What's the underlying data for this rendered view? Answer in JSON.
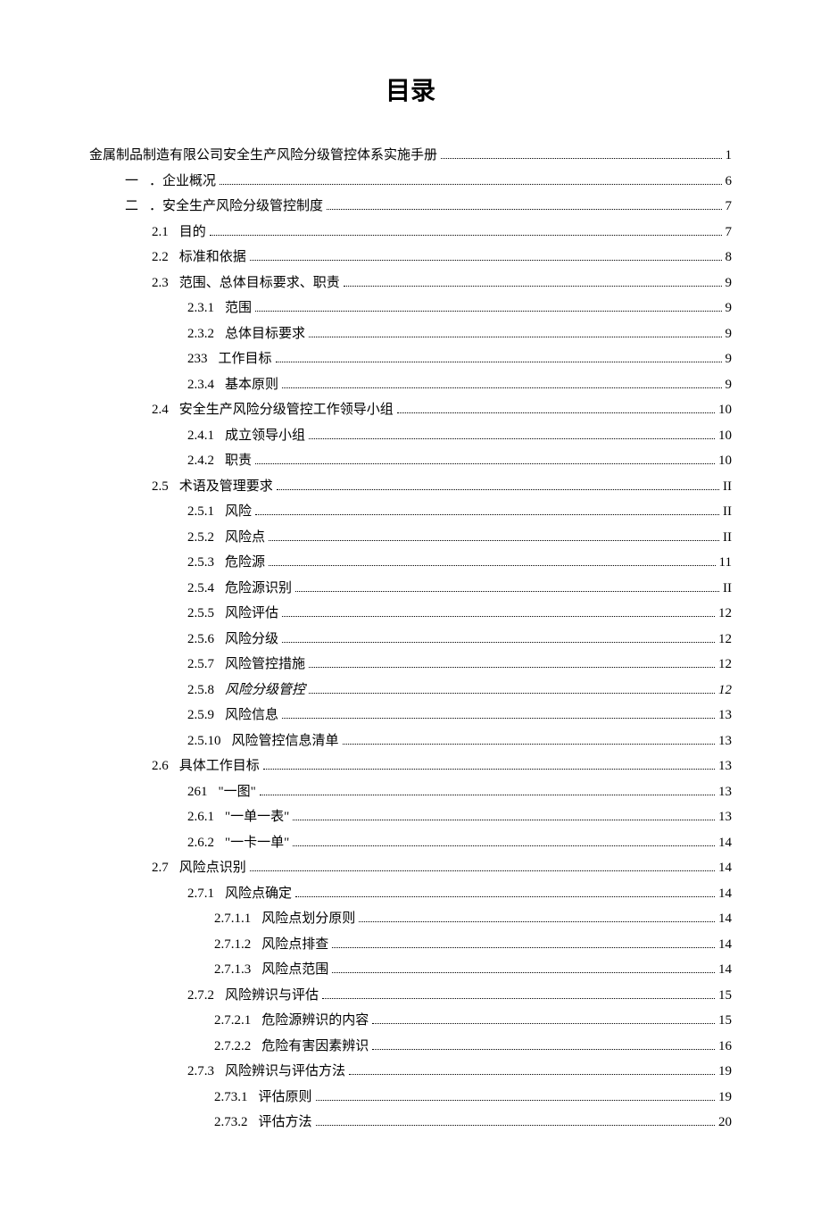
{
  "title": "目录",
  "entries": [
    {
      "indent": 0,
      "num": "",
      "label": "金属制品制造有限公司安全生产风险分级管控体系实施手册",
      "page": "1",
      "italic": false
    },
    {
      "indent": 1,
      "num": "一",
      "label": "．企业概况",
      "page": "6",
      "italic": false
    },
    {
      "indent": 1,
      "num": "二",
      "label": "．安全生产风险分级管控制度",
      "page": "7",
      "italic": false
    },
    {
      "indent": 2,
      "num": "2.1",
      "label": "目的",
      "page": "7",
      "italic": false
    },
    {
      "indent": 2,
      "num": "2.2",
      "label": "标准和依据",
      "page": "8",
      "italic": false
    },
    {
      "indent": 2,
      "num": "2.3",
      "label": "范围、总体目标要求、职责",
      "page": "9",
      "italic": false
    },
    {
      "indent": 3,
      "num": "2.3.1",
      "label": "范围",
      "page": "9",
      "italic": false
    },
    {
      "indent": 3,
      "num": "2.3.2",
      "label": "总体目标要求",
      "page": "9",
      "italic": false
    },
    {
      "indent": 3,
      "num": "233",
      "label": "工作目标",
      "page": "9",
      "italic": false
    },
    {
      "indent": 3,
      "num": "2.3.4",
      "label": "基本原则",
      "page": "9",
      "italic": false
    },
    {
      "indent": 2,
      "num": "2.4",
      "label": "安全生产风险分级管控工作领导小组",
      "page": "10",
      "italic": false
    },
    {
      "indent": 3,
      "num": "2.4.1",
      "label": "成立领导小组",
      "page": "10",
      "italic": false
    },
    {
      "indent": 3,
      "num": "2.4.2",
      "label": "职责",
      "page": "10",
      "italic": false
    },
    {
      "indent": 2,
      "num": "2.5",
      "label": "术语及管理要求",
      "page": "II",
      "italic": false
    },
    {
      "indent": 3,
      "num": "2.5.1",
      "label": "风险",
      "page": "II",
      "italic": false
    },
    {
      "indent": 3,
      "num": "2.5.2",
      "label": "风险点",
      "page": "II",
      "italic": false
    },
    {
      "indent": 3,
      "num": "2.5.3",
      "label": "危险源",
      "page": "11",
      "italic": false
    },
    {
      "indent": 3,
      "num": "2.5.4",
      "label": "危险源识别",
      "page": "II",
      "italic": false
    },
    {
      "indent": 3,
      "num": "2.5.5",
      "label": "风险评估",
      "page": "12",
      "italic": false
    },
    {
      "indent": 3,
      "num": "2.5.6",
      "label": "风险分级",
      "page": "12",
      "italic": false
    },
    {
      "indent": 3,
      "num": "2.5.7",
      "label": "风险管控措施",
      "page": "12",
      "italic": false
    },
    {
      "indent": 3,
      "num": "2.5.8",
      "label": "风险分级管控",
      "page": "12",
      "italic": true
    },
    {
      "indent": 3,
      "num": "2.5.9",
      "label": "风险信息",
      "page": "13",
      "italic": false
    },
    {
      "indent": 3,
      "num": "2.5.10",
      "label": "风险管控信息清单",
      "page": "13",
      "italic": false
    },
    {
      "indent": 2,
      "num": "2.6",
      "label": "具体工作目标",
      "page": "13",
      "italic": false
    },
    {
      "indent": 3,
      "num": "261",
      "label": "\"一图\"",
      "page": "13",
      "italic": false
    },
    {
      "indent": 3,
      "num": "2.6.1",
      "label": "\"一单一表\"",
      "page": "13",
      "italic": false
    },
    {
      "indent": 3,
      "num": "2.6.2",
      "label": "\"一卡一单\"",
      "page": "14",
      "italic": false
    },
    {
      "indent": 2,
      "num": "2.7",
      "label": "风险点识别",
      "page": "14",
      "italic": false
    },
    {
      "indent": 3,
      "num": "2.7.1",
      "label": "风险点确定",
      "page": "14",
      "italic": false
    },
    {
      "indent": 4,
      "num": "2.7.1.1",
      "label": "风险点划分原则",
      "page": "14",
      "italic": false
    },
    {
      "indent": 4,
      "num": "2.7.1.2",
      "label": "风险点排查",
      "page": "14",
      "italic": false
    },
    {
      "indent": 4,
      "num": "2.7.1.3",
      "label": "风险点范围",
      "page": "14",
      "italic": false
    },
    {
      "indent": 3,
      "num": "2.7.2",
      "label": "风险辨识与评估",
      "page": "15",
      "italic": false
    },
    {
      "indent": 4,
      "num": "2.7.2.1",
      "label": "危险源辨识的内容",
      "page": "15",
      "italic": false
    },
    {
      "indent": 4,
      "num": "2.7.2.2",
      "label": "危险有害因素辨识",
      "page": "16",
      "italic": false
    },
    {
      "indent": 3,
      "num": "2.7.3",
      "label": "风险辨识与评估方法",
      "page": "19",
      "italic": false
    },
    {
      "indent": 4,
      "num": "2.73.1",
      "label": "评估原则",
      "page": "19",
      "italic": false
    },
    {
      "indent": 4,
      "num": "2.73.2",
      "label": "评估方法",
      "page": "20",
      "italic": false
    }
  ]
}
